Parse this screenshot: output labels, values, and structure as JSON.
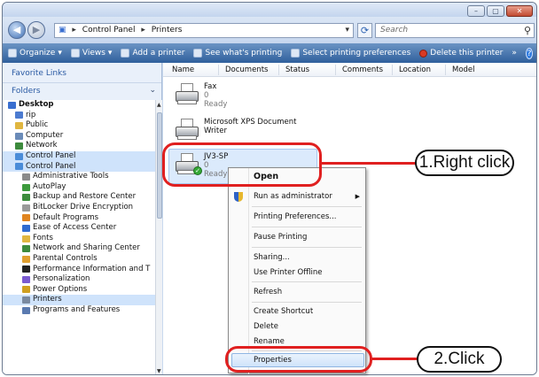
{
  "window": {
    "buttons": [
      "–",
      "▢",
      "✕"
    ]
  },
  "address": {
    "crumbs": [
      "Control Panel",
      "Printers"
    ],
    "search_placeholder": "Search"
  },
  "toolbar": {
    "items": [
      "Organize",
      "Views",
      "Add a printer",
      "See what's printing",
      "Select printing preferences",
      "Delete this printer",
      "»"
    ],
    "help": "?"
  },
  "left_pane": {
    "favorite_links": "Favorite Links",
    "folders": "Folders",
    "tree": [
      {
        "label": "Desktop",
        "indent": 0,
        "color": "#3a6fd0"
      },
      {
        "label": "rip",
        "indent": 1,
        "color": "#4c7bd0"
      },
      {
        "label": "Public",
        "indent": 1,
        "color": "#e0b640"
      },
      {
        "label": "Computer",
        "indent": 1,
        "color": "#6a8bb8"
      },
      {
        "label": "Network",
        "indent": 1,
        "color": "#3d8a3d"
      },
      {
        "label": "Control Panel",
        "indent": 1,
        "color": "#4a8cd8",
        "selected": true
      },
      {
        "label": "Control Panel",
        "indent": 1,
        "color": "#4a8cd8",
        "selected": true
      },
      {
        "label": "Administrative Tools",
        "indent": 2,
        "color": "#8a8a8a"
      },
      {
        "label": "AutoPlay",
        "indent": 2,
        "color": "#3c9a3c"
      },
      {
        "label": "Backup and Restore Center",
        "indent": 2,
        "color": "#3c8c3c"
      },
      {
        "label": "BitLocker Drive Encryption",
        "indent": 2,
        "color": "#9a9a9a"
      },
      {
        "label": "Default Programs",
        "indent": 2,
        "color": "#e0841f"
      },
      {
        "label": "Ease of Access Center",
        "indent": 2,
        "color": "#2f6bd0"
      },
      {
        "label": "Fonts",
        "indent": 2,
        "color": "#e0b640"
      },
      {
        "label": "Network and Sharing Center",
        "indent": 2,
        "color": "#3d8a3d"
      },
      {
        "label": "Parental Controls",
        "indent": 2,
        "color": "#e0a030"
      },
      {
        "label": "Performance Information and T",
        "indent": 2,
        "color": "#222222"
      },
      {
        "label": "Personalization",
        "indent": 2,
        "color": "#7a5ad0"
      },
      {
        "label": "Power Options",
        "indent": 2,
        "color": "#d0a020"
      },
      {
        "label": "Printers",
        "indent": 2,
        "color": "#7a8aa0",
        "selected": true
      },
      {
        "label": "Programs and Features",
        "indent": 2,
        "color": "#5a7ab0"
      }
    ]
  },
  "columns": [
    "Name",
    "Documents",
    "Status",
    "Comments",
    "Location",
    "Model"
  ],
  "printers": [
    {
      "name": "Fax",
      "docs": "0",
      "status": "Ready"
    },
    {
      "name": "Microsoft XPS Document",
      "name2": "Writer"
    },
    {
      "name": "JV3-SP",
      "docs": "0",
      "status": "Ready"
    }
  ],
  "context_menu": {
    "items": [
      "Open",
      "Run as administrator",
      "Printing Preferences...",
      "Pause Printing",
      "Sharing...",
      "Use Printer Offline",
      "Refresh",
      "Create Shortcut",
      "Delete",
      "Rename",
      "Properties"
    ]
  },
  "callouts": {
    "right_click": "1.Right click",
    "click": "2.Click"
  },
  "colors": {
    "highlight_red": "#e02020",
    "toolbar_blue": "#2f5f9c"
  }
}
